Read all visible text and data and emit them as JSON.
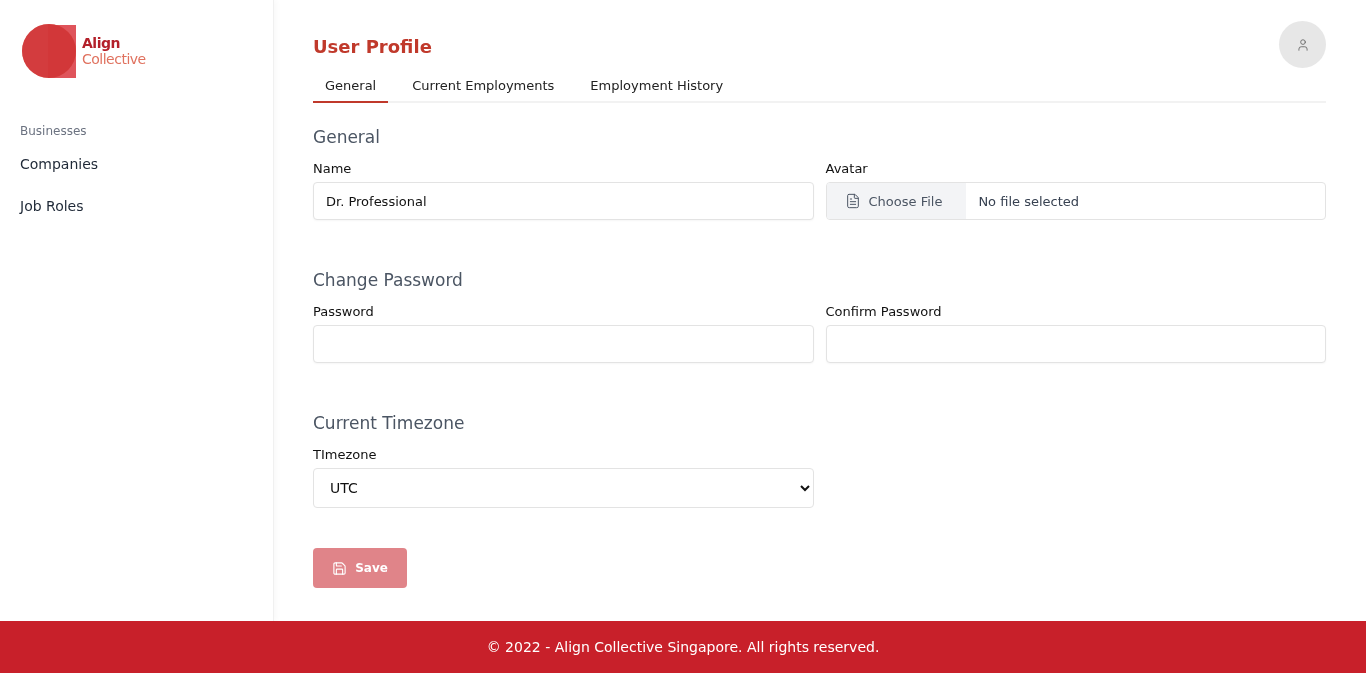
{
  "logo": {
    "line_1": "Align",
    "line_2": "Collective"
  },
  "sidebar": {
    "section": "Businesses",
    "items": [
      {
        "label": "Companies",
        "selected": false
      },
      {
        "label": "Job Roles",
        "selected": false
      }
    ]
  },
  "page": {
    "title": "User Profile"
  },
  "tabs": [
    {
      "label": "General",
      "selected": true
    },
    {
      "label": "Current Employments",
      "selected": false
    },
    {
      "label": "Employment History",
      "selected": false
    }
  ],
  "sections": [
    {
      "title": "General",
      "fields": [
        {
          "kind": "text",
          "label": "Name",
          "value": "Dr. Professional"
        },
        {
          "kind": "file",
          "label": "Avatar",
          "button": "Choose File",
          "status": "No file selected"
        }
      ]
    },
    {
      "title": "Change Password",
      "fields": [
        {
          "kind": "password",
          "label": "Password"
        },
        {
          "kind": "password",
          "label": "Confirm Password"
        }
      ]
    },
    {
      "title": "Current Timezone",
      "fields": [
        {
          "kind": "select",
          "label": "TImezone",
          "value": "UTC"
        }
      ]
    }
  ],
  "save_button": {
    "label": "Save",
    "disabled": true
  },
  "footer": "© 2022 - Align Collective Singapore. All rights reserved."
}
